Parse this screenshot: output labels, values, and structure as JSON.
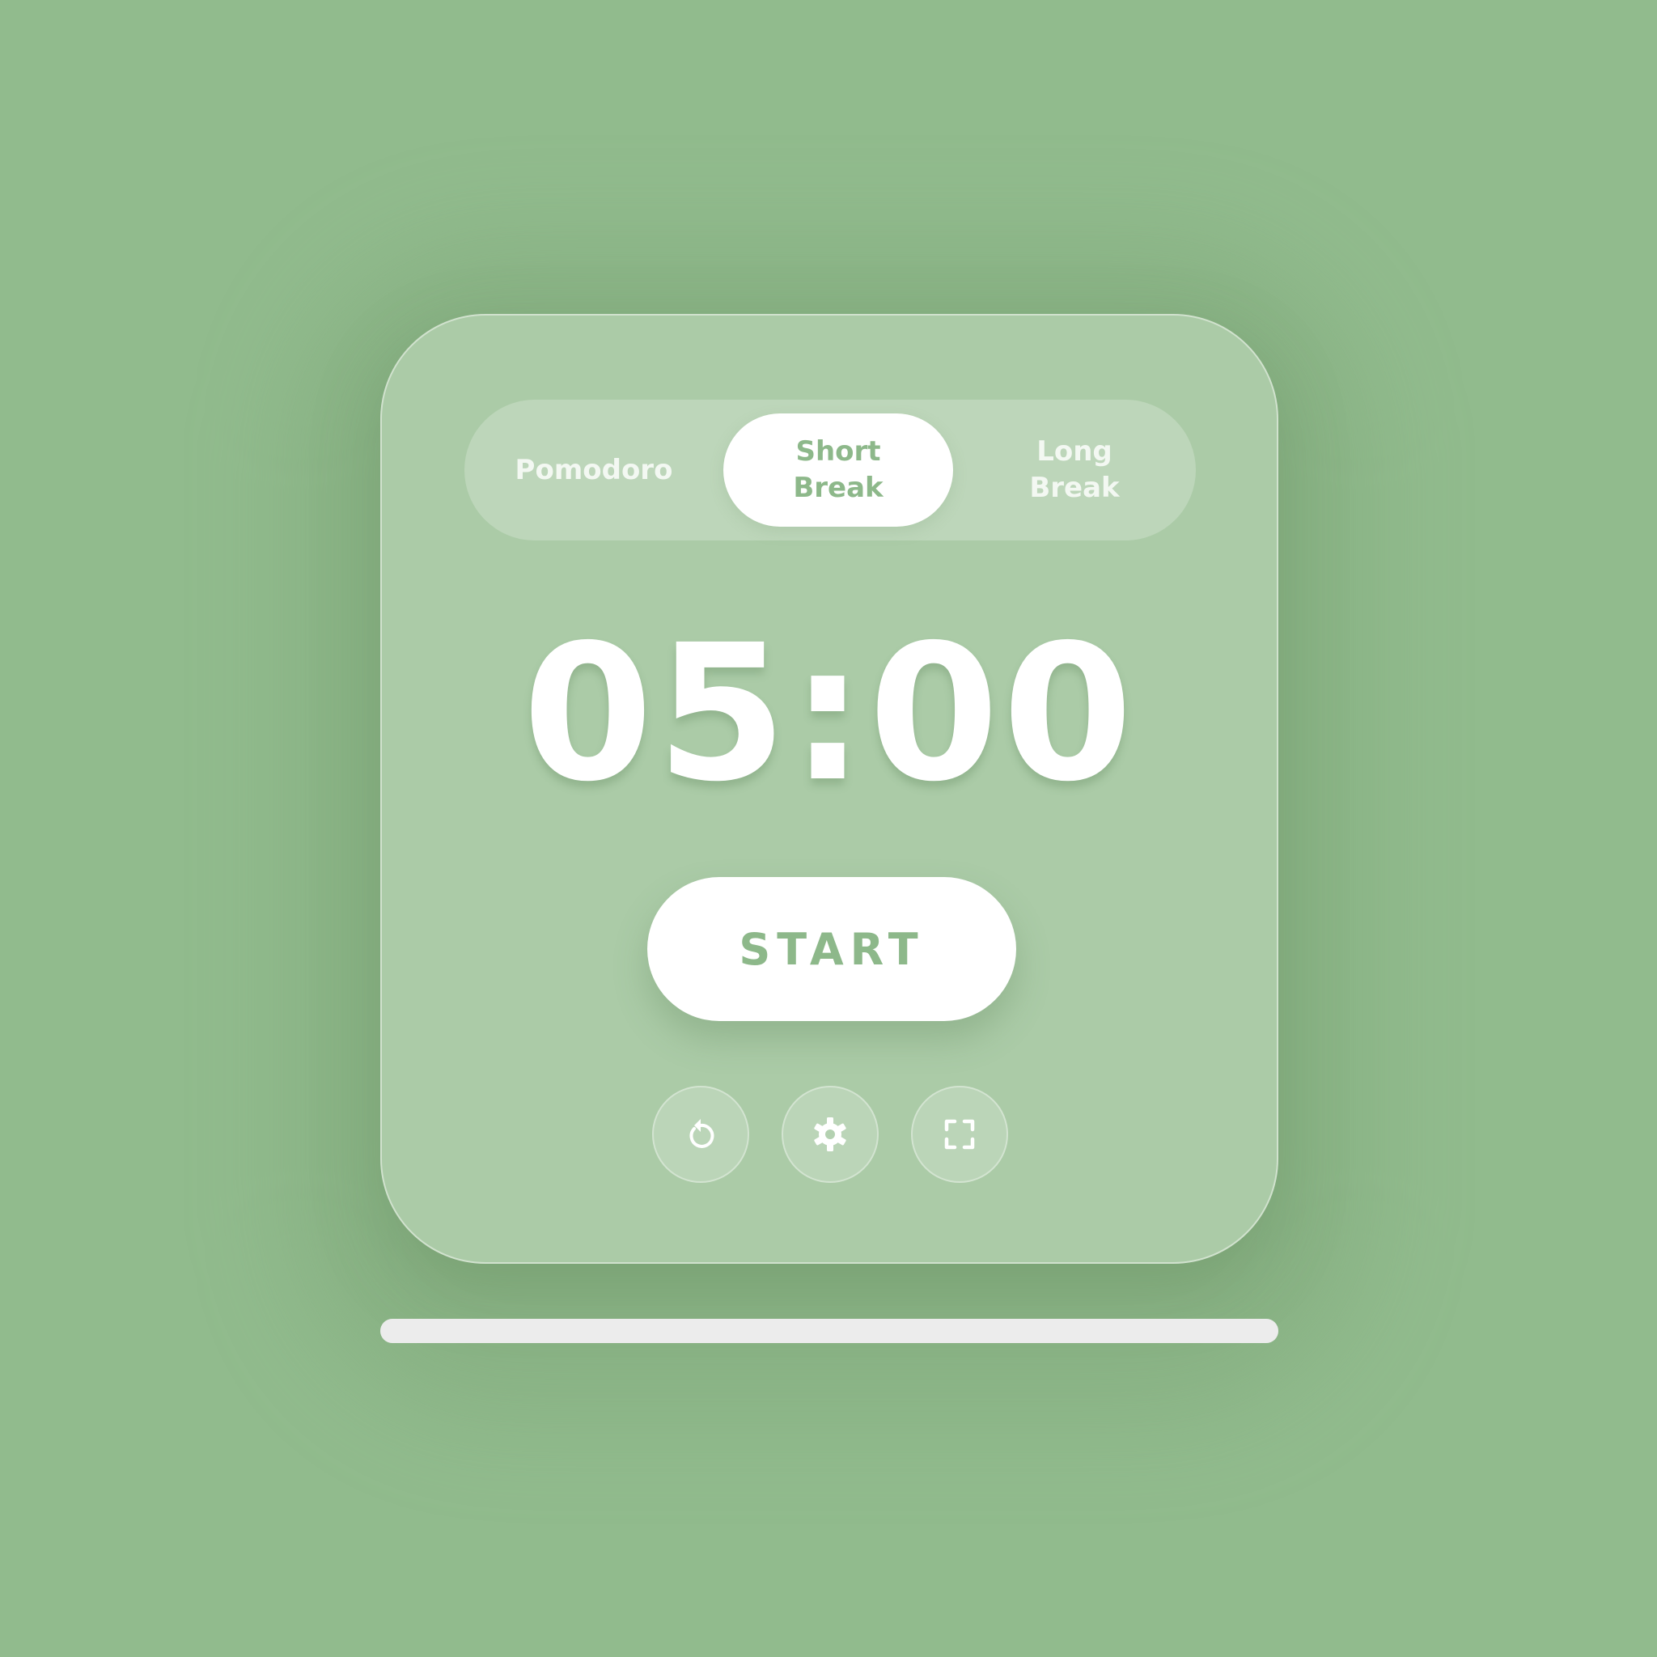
{
  "tabs": [
    {
      "label": "Pomodoro",
      "active": false
    },
    {
      "label": "Short Break",
      "active": true
    },
    {
      "label": "Long Break",
      "active": false
    }
  ],
  "timer": {
    "display": "05:00"
  },
  "controls": {
    "start_label": "START",
    "reset_icon": "reset-icon",
    "settings_icon": "gear-icon",
    "fullscreen_icon": "fullscreen-icon"
  },
  "progress": {
    "fraction": 1.0
  },
  "colors": {
    "background": "#91bb8d",
    "card": "#abcba7",
    "accent": "#8db88a",
    "button": "#ffffff",
    "progress_fill": "#ececec"
  }
}
